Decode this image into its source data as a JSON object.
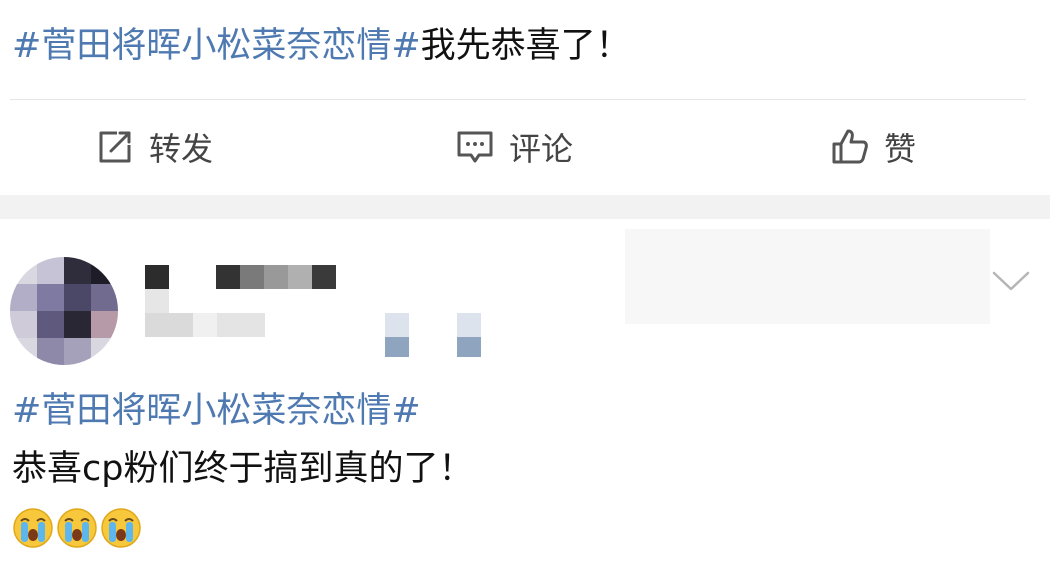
{
  "post": {
    "hashtag": "#菅田将晖小松菜奈恋情#",
    "text": "我先恭喜了！"
  },
  "actions": {
    "repost_label": "转发",
    "comment_label": "评论",
    "like_label": "赞"
  },
  "comment": {
    "hashtag": "#菅田将晖小松菜奈恋情#",
    "text": "恭喜cp粉们终于搞到真的了！",
    "emojis": [
      "crying-face",
      "crying-face",
      "crying-face"
    ]
  },
  "colors": {
    "hashtag": "#4e79b1",
    "separator": "#f2f2f2",
    "icon": "#555555"
  }
}
